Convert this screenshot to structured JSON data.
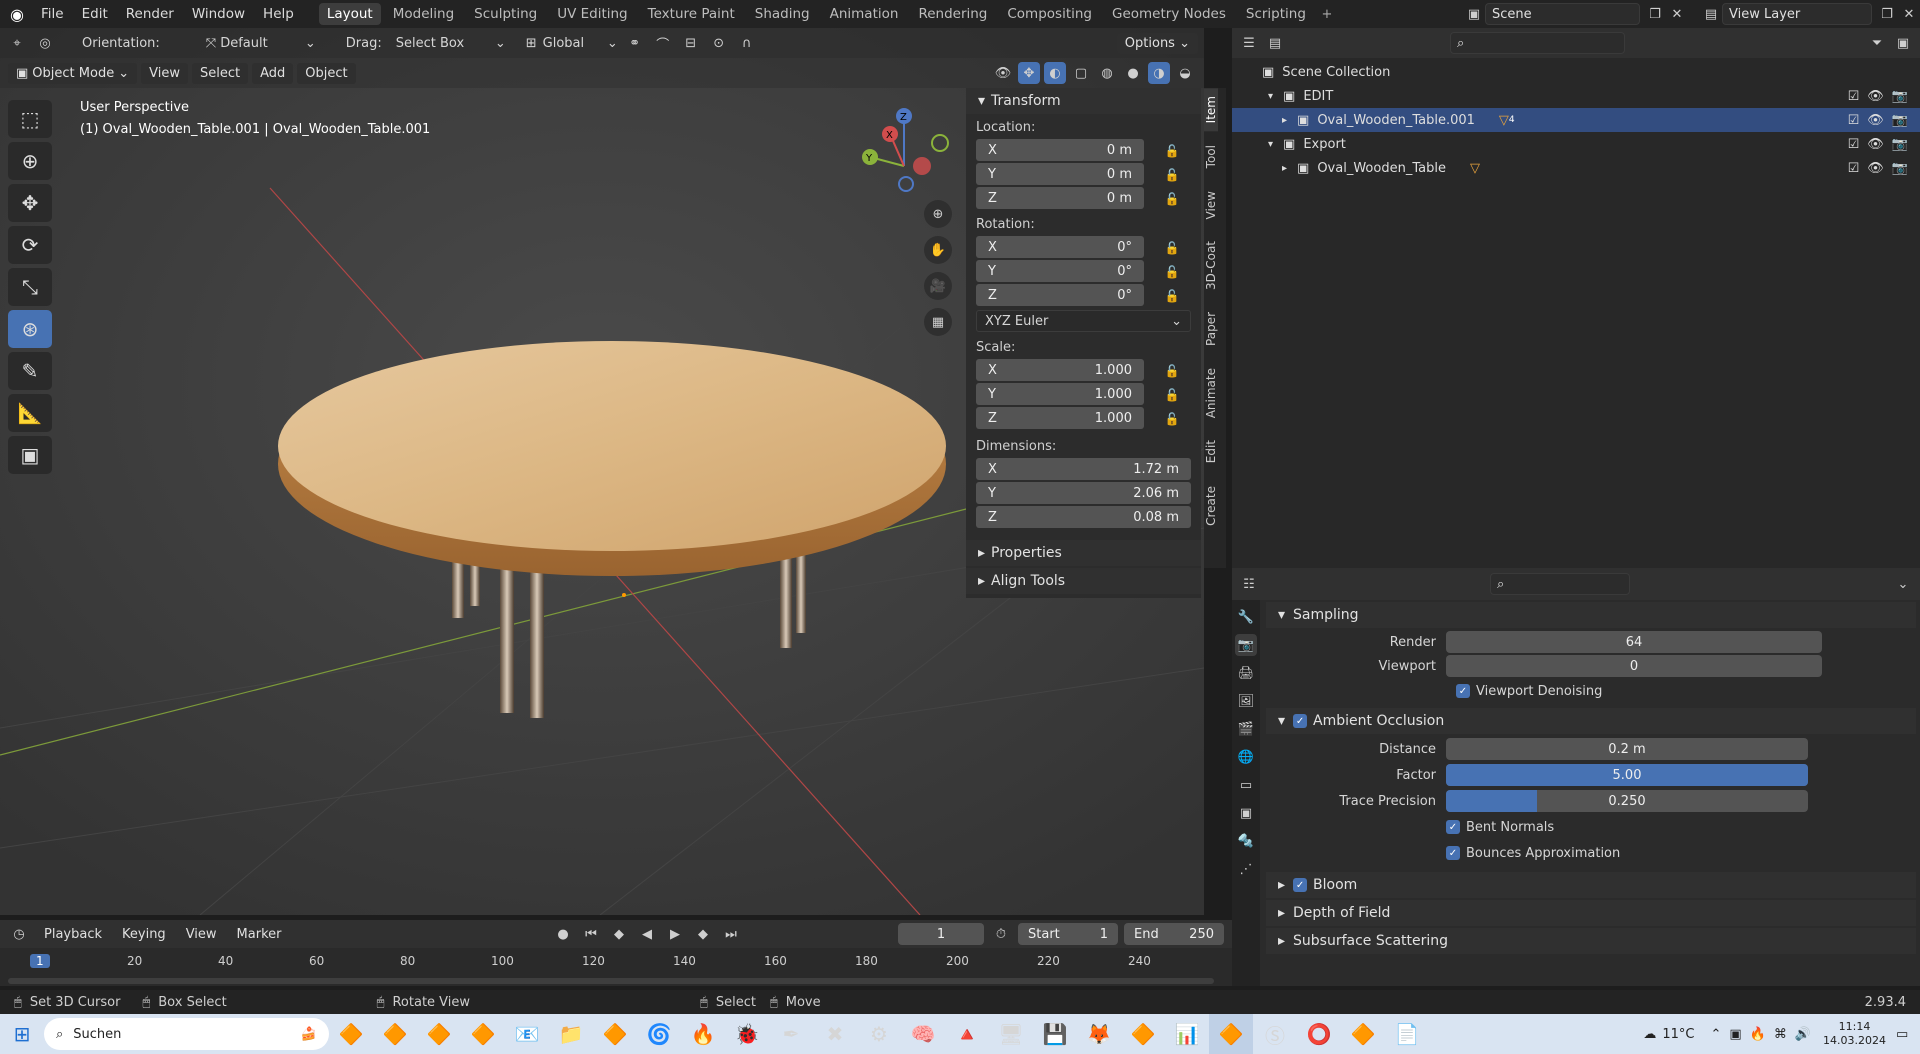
{
  "menu": [
    "File",
    "Edit",
    "Render",
    "Window",
    "Help"
  ],
  "workspaces": [
    "Layout",
    "Modeling",
    "Sculpting",
    "UV Editing",
    "Texture Paint",
    "Shading",
    "Animation",
    "Rendering",
    "Compositing",
    "Geometry Nodes",
    "Scripting"
  ],
  "scene": {
    "label": "Scene",
    "view_layer": "View Layer"
  },
  "header": {
    "orientation_label": "Orientation:",
    "orientation_value": "Default",
    "drag_label": "Drag:",
    "drag_value": "Select Box",
    "transform_space": "Global",
    "options": "Options"
  },
  "viewport": {
    "mode": "Object Mode",
    "menus": [
      "View",
      "Select",
      "Add",
      "Object"
    ],
    "perspective": "User Perspective",
    "object_info": "(1) Oval_Wooden_Table.001 | Oval_Wooden_Table.001"
  },
  "npanel": {
    "transform": "Transform",
    "location_label": "Location:",
    "location": [
      {
        "axis": "X",
        "value": "0 m"
      },
      {
        "axis": "Y",
        "value": "0 m"
      },
      {
        "axis": "Z",
        "value": "0 m"
      }
    ],
    "rotation_label": "Rotation:",
    "rotation": [
      {
        "axis": "X",
        "value": "0°"
      },
      {
        "axis": "Y",
        "value": "0°"
      },
      {
        "axis": "Z",
        "value": "0°"
      }
    ],
    "rotation_mode": "XYZ Euler",
    "scale_label": "Scale:",
    "scale": [
      {
        "axis": "X",
        "value": "1.000"
      },
      {
        "axis": "Y",
        "value": "1.000"
      },
      {
        "axis": "Z",
        "value": "1.000"
      }
    ],
    "dimensions_label": "Dimensions:",
    "dimensions": [
      {
        "axis": "X",
        "value": "1.72 m"
      },
      {
        "axis": "Y",
        "value": "2.06 m"
      },
      {
        "axis": "Z",
        "value": "0.08 m"
      }
    ],
    "properties": "Properties",
    "align_tools": "Align Tools",
    "tabs": [
      "Item",
      "Tool",
      "View",
      "3D-Coat",
      "Paper",
      "Animate",
      "Edit",
      "Create"
    ]
  },
  "outliner": {
    "root": "Scene Collection",
    "items": [
      {
        "name": "EDIT",
        "level": 1,
        "type": "collection"
      },
      {
        "name": "Oval_Wooden_Table.001",
        "level": 2,
        "type": "object",
        "selected": true,
        "badge": "4"
      },
      {
        "name": "Export",
        "level": 1,
        "type": "collection"
      },
      {
        "name": "Oval_Wooden_Table",
        "level": 2,
        "type": "object"
      }
    ]
  },
  "properties": {
    "sampling": "Sampling",
    "render_label": "Render",
    "render_value": "64",
    "viewport_label": "Viewport",
    "viewport_value": "0",
    "viewport_denoising": "Viewport Denoising",
    "ao": "Ambient Occlusion",
    "distance_label": "Distance",
    "distance_value": "0.2 m",
    "factor_label": "Factor",
    "factor_value": "5.00",
    "factor_fill": 1.0,
    "trace_label": "Trace Precision",
    "trace_value": "0.250",
    "trace_fill": 0.25,
    "bent_normals": "Bent Normals",
    "bounces": "Bounces Approximation",
    "bloom": "Bloom",
    "dof": "Depth of Field",
    "sss": "Subsurface Scattering"
  },
  "timeline": {
    "menus": [
      "Playback",
      "Keying",
      "View",
      "Marker"
    ],
    "current_frame": "1",
    "start_label": "Start",
    "start_value": "1",
    "end_label": "End",
    "end_value": "250",
    "ticks": [
      "1",
      "20",
      "40",
      "60",
      "80",
      "100",
      "120",
      "140",
      "160",
      "180",
      "200",
      "220",
      "240"
    ]
  },
  "status": {
    "items": [
      "Set 3D Cursor",
      "Box Select",
      "Rotate View",
      "Select",
      "Move"
    ],
    "version": "2.93.4"
  },
  "taskbar": {
    "search": "Suchen",
    "weather": "11°C",
    "time": "11:14",
    "date": "14.03.2024"
  },
  "colors": {
    "accent": "#4772b3",
    "selection": "#334d80",
    "viewport_bg": "#393939"
  }
}
